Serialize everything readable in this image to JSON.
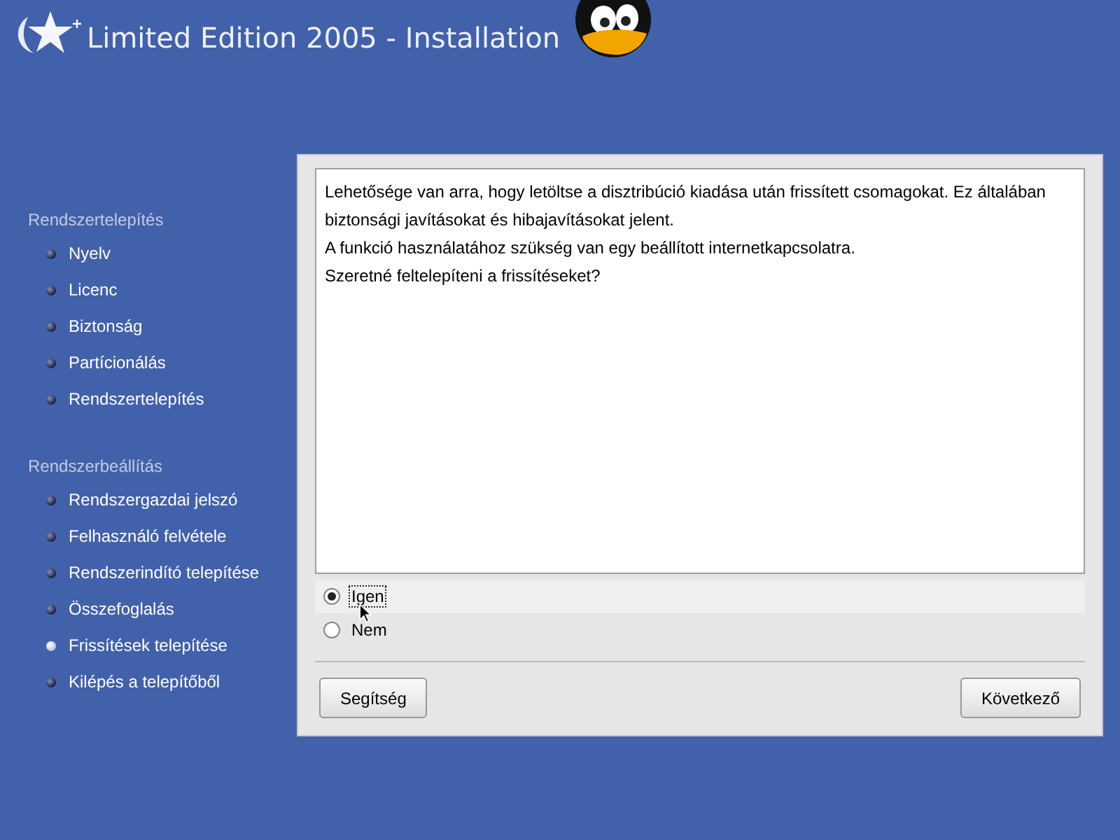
{
  "header": {
    "title": "Limited Edition 2005 - Installation"
  },
  "sidebar": {
    "sections": [
      {
        "heading": "Rendszertelepítés",
        "items": [
          {
            "label": "Nyelv",
            "current": false
          },
          {
            "label": "Licenc",
            "current": false
          },
          {
            "label": "Biztonság",
            "current": false
          },
          {
            "label": "Partícionálás",
            "current": false
          },
          {
            "label": "Rendszertelepítés",
            "current": false
          }
        ]
      },
      {
        "heading": "Rendszerbeállítás",
        "items": [
          {
            "label": "Rendszergazdai jelszó",
            "current": false
          },
          {
            "label": "Felhasználó felvétele",
            "current": false
          },
          {
            "label": "Rendszerindító telepítése",
            "current": false
          },
          {
            "label": "Összefoglalás",
            "current": false
          },
          {
            "label": "Frissítések telepítése",
            "current": true
          },
          {
            "label": "Kilépés a telepítőből",
            "current": false
          }
        ]
      }
    ]
  },
  "message": [
    "Lehetősége van arra, hogy letöltse a disztribúció kiadása után frissített csomagokat. Ez általában biztonsági javításokat és hibajavításokat jelent.",
    "A funkció használatához szükség van egy beállított internetkapcsolatra.",
    "Szeretné feltelepíteni a frissítéseket?"
  ],
  "options": [
    {
      "label": "Igen",
      "selected": true,
      "focused": true
    },
    {
      "label": "Nem",
      "selected": false,
      "focused": false
    }
  ],
  "buttons": [
    "Segítség",
    "Következő"
  ]
}
